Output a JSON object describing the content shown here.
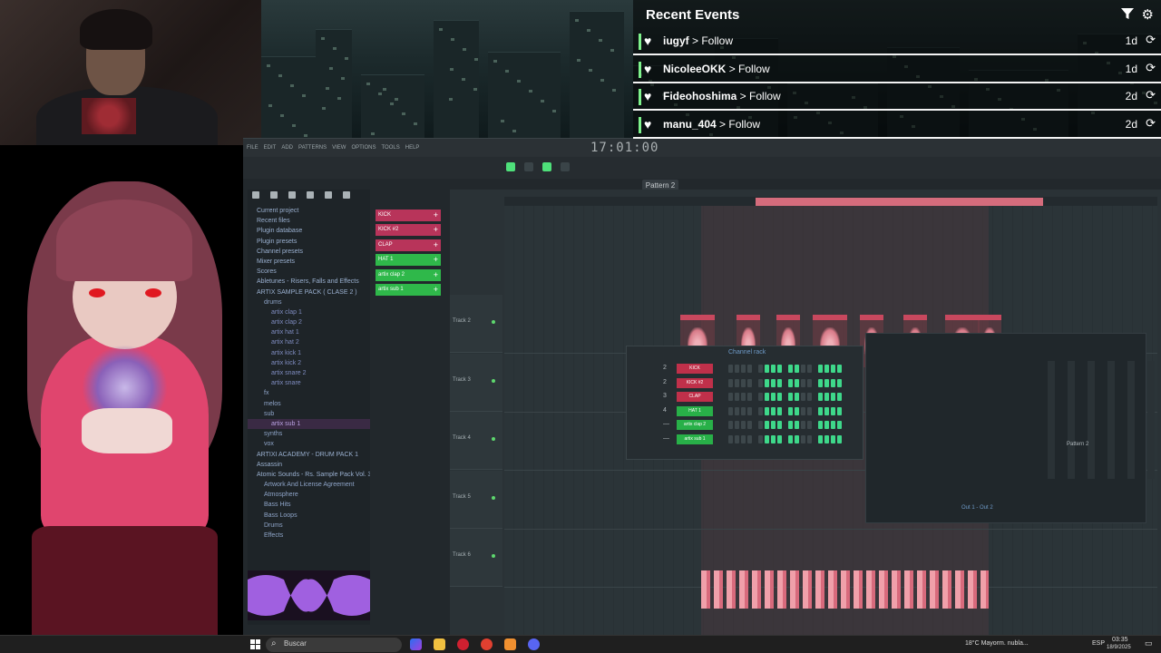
{
  "events": {
    "title": "Recent Events",
    "items": [
      {
        "user": "iugyf",
        "action": " > Follow",
        "age": "1d"
      },
      {
        "user": "NicoleeOKK",
        "action": " > Follow",
        "age": "1d"
      },
      {
        "user": "Fideohoshima",
        "action": " > Follow",
        "age": "2d"
      },
      {
        "user": "manu_404",
        "action": " > Follow",
        "age": "2d"
      }
    ]
  },
  "fl": {
    "menu": [
      "FILE",
      "EDIT",
      "ADD",
      "PATTERNS",
      "VIEW",
      "OPTIONS",
      "TOOLS",
      "HELP"
    ],
    "time": "17:01:00",
    "pattern": "Pattern 2",
    "browser_items": [
      {
        "label": "Current project",
        "level": 0
      },
      {
        "label": "Recent files",
        "level": 0
      },
      {
        "label": "Plugin database",
        "level": 0
      },
      {
        "label": "Plugin presets",
        "level": 0
      },
      {
        "label": "Channel presets",
        "level": 0
      },
      {
        "label": "Mixer presets",
        "level": 0
      },
      {
        "label": "Scores",
        "level": 0
      },
      {
        "label": "Abletunes - Risers, Falls and Effects",
        "level": 0
      },
      {
        "label": "ARTIX SAMPLE PACK ( CLASE 2 )",
        "level": 0
      },
      {
        "label": "drums",
        "level": 1
      },
      {
        "label": "artix clap 1",
        "level": 2
      },
      {
        "label": "artix clap 2",
        "level": 2
      },
      {
        "label": "artix hat 1",
        "level": 2
      },
      {
        "label": "artix hat 2",
        "level": 2
      },
      {
        "label": "artix kick 1",
        "level": 2
      },
      {
        "label": "artix kick 2",
        "level": 2
      },
      {
        "label": "artix snare 2",
        "level": 2
      },
      {
        "label": "artix snare",
        "level": 2
      },
      {
        "label": "fx",
        "level": 1
      },
      {
        "label": "melos",
        "level": 1
      },
      {
        "label": "sub",
        "level": 1
      },
      {
        "label": "artix sub 1",
        "level": 2,
        "highlight": true
      },
      {
        "label": "synths",
        "level": 1
      },
      {
        "label": "vox",
        "level": 1
      },
      {
        "label": "ARTIXI ACADEMY - DRUM PACK 1",
        "level": 0
      },
      {
        "label": "Assassin",
        "level": 0
      },
      {
        "label": "Atomic Sounds - Rs. Sample Pack Vol. 3",
        "level": 0
      },
      {
        "label": "Artwork And License Agreement",
        "level": 1
      },
      {
        "label": "Atmosphere",
        "level": 1
      },
      {
        "label": "Bass Hits",
        "level": 1
      },
      {
        "label": "Bass Loops",
        "level": 1
      },
      {
        "label": "Drums",
        "level": 1
      },
      {
        "label": "Effects",
        "level": 1
      }
    ],
    "channels": [
      {
        "name": "KICK",
        "color": "#b8345a"
      },
      {
        "name": "KICK #2",
        "color": "#b8345a"
      },
      {
        "name": "CLAP",
        "color": "#b8345a"
      },
      {
        "name": "HAT 1",
        "color": "#2fb84a"
      },
      {
        "name": "artix clap 2",
        "color": "#2fb84a"
      },
      {
        "name": "artix sub 1",
        "color": "#2fb84a"
      }
    ],
    "tracks": [
      "Track 2",
      "Track 3",
      "Track 4",
      "Track 5",
      "Track 6"
    ],
    "rack": {
      "title": "Channel rack",
      "rows": [
        {
          "num": "2",
          "name": "KICK",
          "color": "#c0304a"
        },
        {
          "num": "2",
          "name": "KICK #2",
          "color": "#c0304a"
        },
        {
          "num": "3",
          "name": "CLAP",
          "color": "#c0304a"
        },
        {
          "num": "4",
          "name": "HAT 1",
          "color": "#28b048"
        },
        {
          "num": "—",
          "name": "artix clap 2",
          "color": "#28b048"
        },
        {
          "num": "—",
          "name": "artix sub 1",
          "color": "#28b048"
        }
      ]
    },
    "mixer_out": "Out 1 - Out 2",
    "pattern_tag": "Pattern 2"
  },
  "taskbar": {
    "search_placeholder": "Buscar",
    "weather": "18°C  Mayorm. nubla...",
    "lang": "ESP",
    "time": "03:35",
    "date": "18/9/2025"
  },
  "colors": {
    "accent": "#3ed88a",
    "clip": "#d56c7c",
    "follow_bar": "#7ef28c"
  }
}
